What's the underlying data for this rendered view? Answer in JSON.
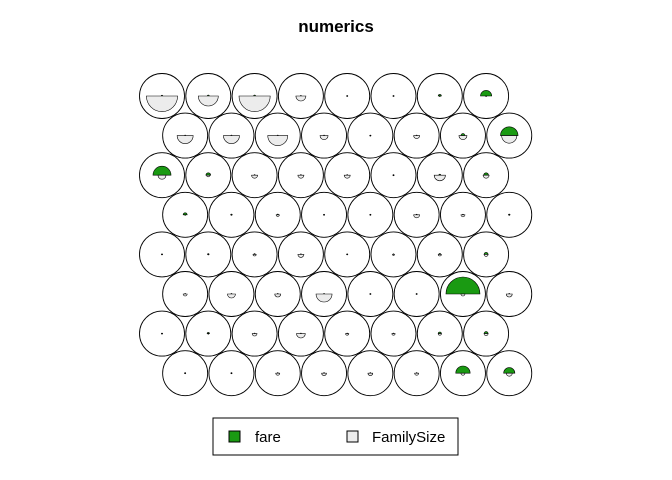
{
  "chart_data": {
    "type": "som-codes-segments",
    "title": "numerics",
    "grid": {
      "rows": 8,
      "cols": 8,
      "topology": "hexagonal",
      "row_order": "top-to-bottom"
    },
    "series": [
      {
        "name": "fare",
        "color": "#1a9a12",
        "segment": "upper-half"
      },
      {
        "name": "FamilySize",
        "color": "#ececec",
        "segment": "lower-half"
      }
    ],
    "legend": {
      "position": "bottom",
      "entries": [
        "fare",
        "FamilySize"
      ]
    },
    "values": {
      "fare": [
        [
          0.04,
          0.05,
          0.05,
          0.03,
          0.02,
          0.02,
          0.08,
          0.28
        ],
        [
          0.03,
          0.03,
          0.03,
          0.03,
          0.02,
          0.03,
          0.1,
          0.44
        ],
        [
          0.45,
          0.12,
          0.03,
          0.03,
          0.02,
          0.02,
          0.05,
          0.12
        ],
        [
          0.1,
          0.04,
          0.04,
          0.02,
          0.02,
          0.03,
          0.03,
          0.04
        ],
        [
          0.02,
          0.04,
          0.04,
          0.03,
          0.03,
          0.03,
          0.05,
          0.1
        ],
        [
          0.03,
          0.03,
          0.02,
          0.02,
          0.02,
          0.03,
          0.85,
          0.03
        ],
        [
          0.03,
          0.06,
          0.03,
          0.02,
          0.02,
          0.02,
          0.08,
          0.1
        ],
        [
          0.02,
          0.01,
          0.03,
          0.02,
          0.03,
          0.03,
          0.36,
          0.28
        ]
      ],
      "FamilySize": [
        [
          0.78,
          0.5,
          0.78,
          0.25,
          0.02,
          0.02,
          0.02,
          0.02
        ],
        [
          0.4,
          0.4,
          0.5,
          0.2,
          0.02,
          0.15,
          0.2,
          0.38
        ],
        [
          0.2,
          0.08,
          0.15,
          0.15,
          0.15,
          0.02,
          0.28,
          0.15
        ],
        [
          0.02,
          0.02,
          0.08,
          0.02,
          0.02,
          0.15,
          0.1,
          0.02
        ],
        [
          0.02,
          0.02,
          0.08,
          0.15,
          0.02,
          0.05,
          0.08,
          0.1
        ],
        [
          0.1,
          0.2,
          0.15,
          0.4,
          0.02,
          0.02,
          0.1,
          0.15
        ],
        [
          0.02,
          0.02,
          0.12,
          0.22,
          0.08,
          0.08,
          0.08,
          0.1
        ],
        [
          0.02,
          0.02,
          0.1,
          0.12,
          0.12,
          0.1,
          0.1,
          0.15
        ]
      ]
    }
  }
}
